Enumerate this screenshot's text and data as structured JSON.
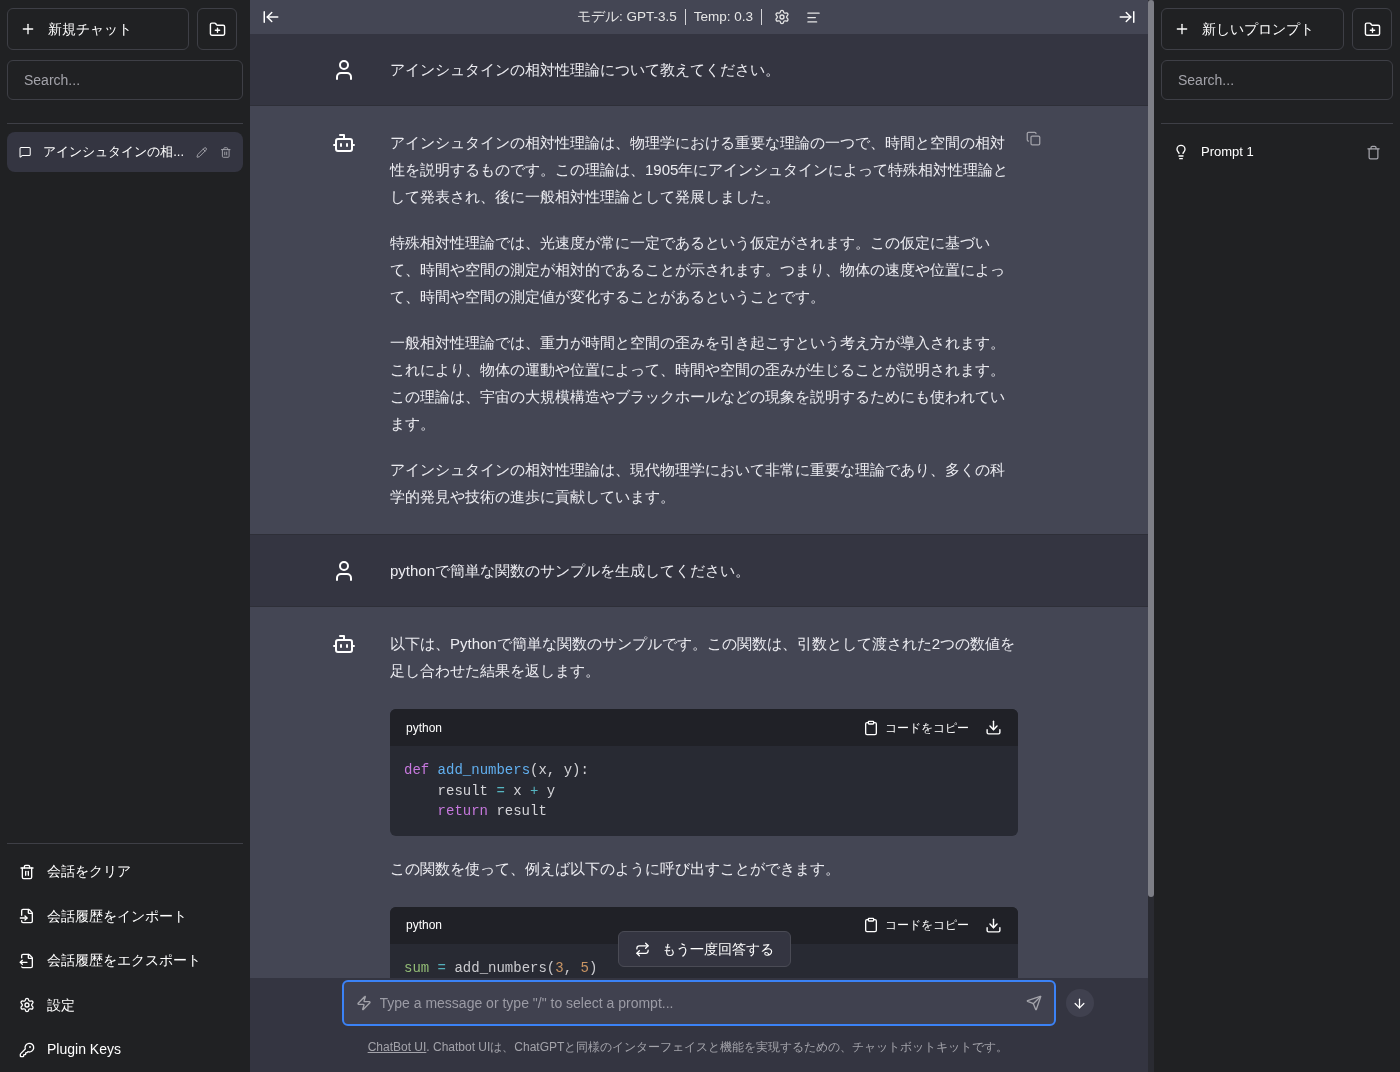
{
  "left_sidebar": {
    "new_chat_button": "新規チャット",
    "search": {
      "placeholder": "Search..."
    },
    "conversations": [
      {
        "title": "アインシュタインの相...",
        "selected": true
      }
    ],
    "footer_items": [
      {
        "kind": "clear",
        "label": "会話をクリア"
      },
      {
        "kind": "import",
        "label": "会話履歴をインポート"
      },
      {
        "kind": "export",
        "label": "会話履歴をエクスポート"
      },
      {
        "kind": "settings",
        "label": "設定"
      },
      {
        "kind": "keys",
        "label": "Plugin Keys"
      }
    ]
  },
  "header": {
    "model": "モデル: GPT-3.5",
    "temp": "Temp: 0.3"
  },
  "messages": [
    {
      "kind": "user",
      "blocks": [
        {
          "kind": "text",
          "text": "アインシュタインの相対性理論について教えてください。"
        }
      ]
    },
    {
      "kind": "assistant",
      "blocks": [
        {
          "kind": "text",
          "text": "アインシュタインの相対性理論は、物理学における重要な理論の一つで、時間と空間の相対性を説明するものです。この理論は、1905年にアインシュタインによって特殊相対性理論として発表され、後に一般相対性理論として発展しました。"
        },
        {
          "kind": "text",
          "text": "特殊相対性理論では、光速度が常に一定であるという仮定がされます。この仮定に基づいて、時間や空間の測定が相対的であることが示されます。つまり、物体の速度や位置によって、時間や空間の測定値が変化することがあるということです。"
        },
        {
          "kind": "text",
          "text": "一般相対性理論では、重力が時間と空間の歪みを引き起こすという考え方が導入されます。これにより、物体の運動や位置によって、時間や空間の歪みが生じることが説明されます。この理論は、宇宙の大規模構造やブラックホールなどの現象を説明するためにも使われています。"
        },
        {
          "kind": "text",
          "text": "アインシュタインの相対性理論は、現代物理学において非常に重要な理論であり、多くの科学的発見や技術の進歩に貢献しています。"
        }
      ]
    },
    {
      "kind": "user",
      "blocks": [
        {
          "kind": "text",
          "text": "pythonで簡単な関数のサンプルを生成してください。"
        }
      ]
    },
    {
      "kind": "assistant",
      "blocks": [
        {
          "kind": "text",
          "text": "以下は、Pythonで簡単な関数のサンプルです。この関数は、引数として渡された2つの数値を足し合わせた結果を返します。"
        },
        {
          "kind": "code",
          "language": "python",
          "copy_label": "コードをコピー",
          "lines": [
            [
              {
                "kind": "keyword",
                "text": "def"
              },
              {
                "kind": "function",
                "text": " add_numbers"
              },
              {
                "kind": "plain",
                "text": "(x, y):"
              }
            ],
            [
              {
                "kind": "plain",
                "text": "    result "
              },
              {
                "kind": "operator",
                "text": "="
              },
              {
                "kind": "plain",
                "text": " x "
              },
              {
                "kind": "operator",
                "text": "+"
              },
              {
                "kind": "plain",
                "text": " y"
              }
            ],
            [
              {
                "kind": "keyword",
                "text": "    return"
              },
              {
                "kind": "plain",
                "text": " result"
              }
            ]
          ]
        },
        {
          "kind": "text",
          "text": "この関数を使って、例えば以下のように呼び出すことができます。"
        },
        {
          "kind": "code",
          "language": "python",
          "copy_label": "コードをコピー",
          "lines": [
            [
              {
                "kind": "variable",
                "text": "sum"
              },
              {
                "kind": "operator",
                "text": " ="
              },
              {
                "kind": "plain",
                "text": " add_numbers("
              },
              {
                "kind": "number",
                "text": "3"
              },
              {
                "kind": "plain",
                "text": ", "
              },
              {
                "kind": "number",
                "text": "5"
              },
              {
                "kind": "plain",
                "text": ")"
              }
            ]
          ]
        }
      ]
    }
  ],
  "regenerate_button": "もう一度回答する",
  "input": {
    "placeholder": "Type a message or type \"/\" to select a prompt..."
  },
  "footer": {
    "link": "ChatBot UI",
    "text": ". Chatbot UIは、ChatGPTと同様のインターフェイスと機能を実現するための、チャットボットキットです。"
  },
  "right_sidebar": {
    "new_prompt_button": "新しいプロンプト",
    "search": {
      "placeholder": "Search..."
    },
    "prompts": [
      {
        "name": "Prompt 1"
      }
    ]
  }
}
